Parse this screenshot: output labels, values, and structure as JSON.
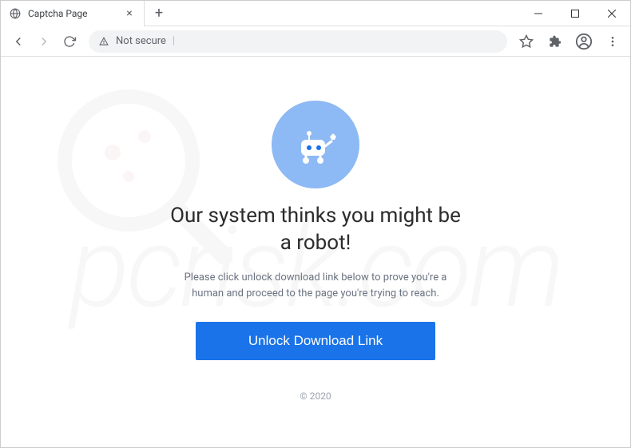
{
  "window": {
    "tab_title": "Captcha Page"
  },
  "toolbar": {
    "security_label": "Not secure"
  },
  "page": {
    "heading": "Our system thinks you might be a robot!",
    "subtext": "Please click unlock download link below to prove you're a human and proceed to the page you're trying to reach.",
    "button_label": "Unlock Download Link",
    "copyright": "© 2020"
  },
  "watermark": {
    "text": "pcrisk.com"
  }
}
